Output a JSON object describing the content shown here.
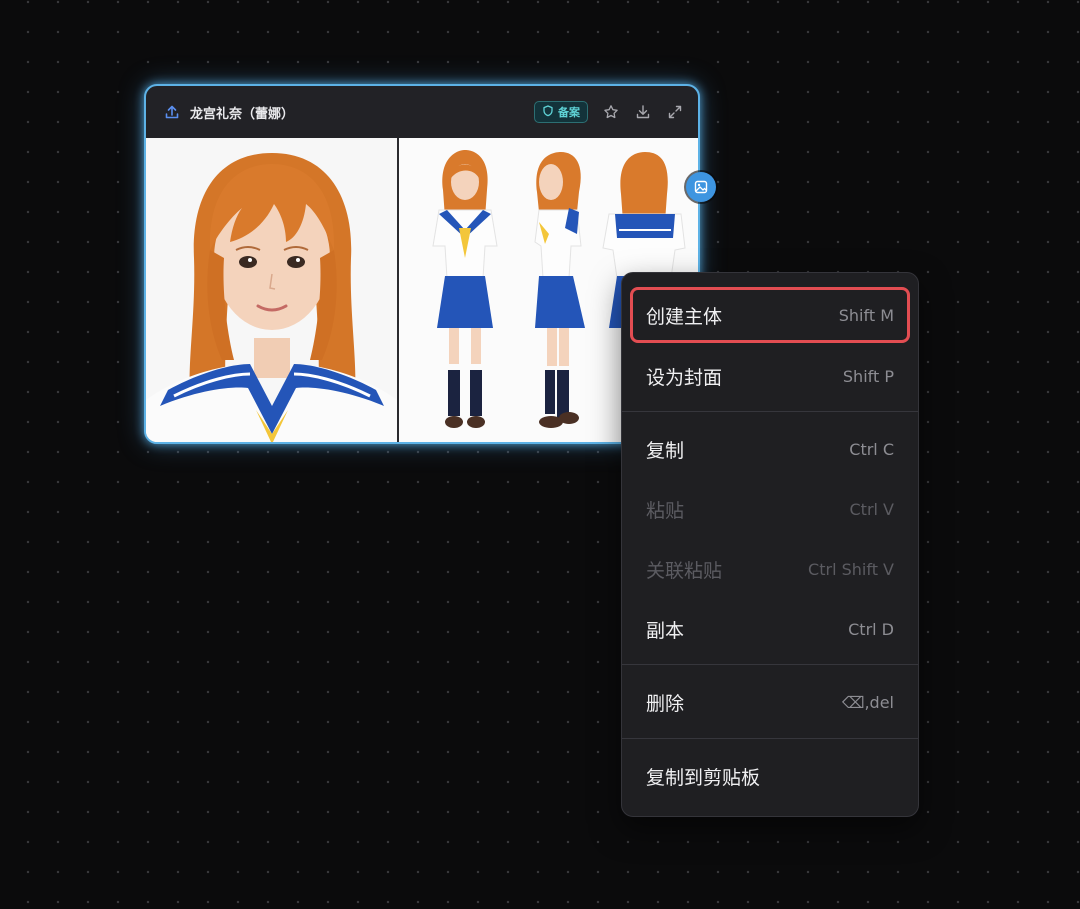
{
  "node": {
    "title": "龙宫礼奈（蕾娜）",
    "badge_label": "备案",
    "icons": [
      "upload-icon",
      "shield-icon",
      "star-icon",
      "download-icon",
      "expand-icon",
      "image-icon"
    ],
    "colors": {
      "border": "#5db2e6",
      "badge_text": "#5fd3d6",
      "hair": "#d97a2c",
      "uniform": "#2455b8"
    }
  },
  "menu": {
    "items": [
      {
        "label": "创建主体",
        "shortcut": "Shift M",
        "enabled": true,
        "highlighted": true
      },
      {
        "label": "设为封面",
        "shortcut": "Shift P",
        "enabled": true
      },
      {
        "label": "复制",
        "shortcut": "Ctrl C",
        "enabled": true
      },
      {
        "label": "粘贴",
        "shortcut": "Ctrl V",
        "enabled": false
      },
      {
        "label": "关联粘贴",
        "shortcut": "Ctrl Shift V",
        "enabled": false
      },
      {
        "label": "副本",
        "shortcut": "Ctrl D",
        "enabled": true
      },
      {
        "label": "删除",
        "shortcut": "⌫,del",
        "enabled": true
      },
      {
        "label": "复制到剪贴板",
        "shortcut": "",
        "enabled": true
      }
    ],
    "highlight_color": "#e24d52"
  }
}
